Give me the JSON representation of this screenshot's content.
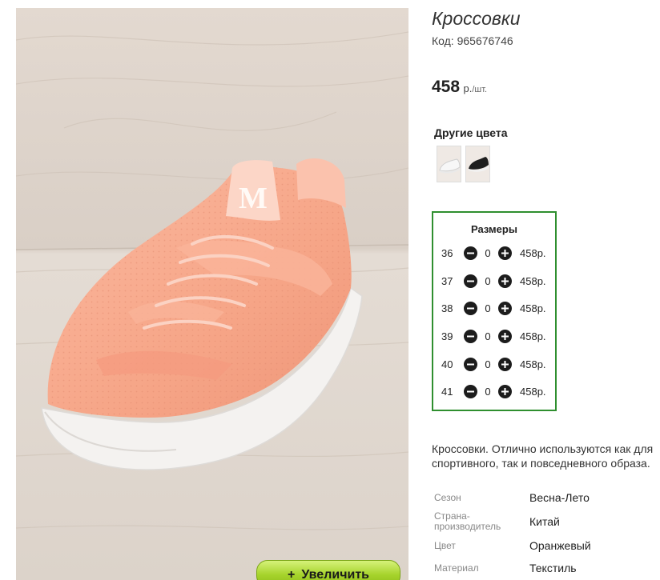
{
  "product": {
    "title": "Кроссовки",
    "code": "Код: 965676746",
    "price_value": "458",
    "price_unit_r": "р.",
    "price_unit_sht": "/шт."
  },
  "photo": {
    "zoom_icon": "+",
    "zoom_label": "Увеличить"
  },
  "colors": {
    "heading": "Другие цвета",
    "swatches": [
      {
        "name": "white-sneaker",
        "color": "#f4f4f4"
      },
      {
        "name": "black-sneaker",
        "color": "#1e1e1e"
      }
    ]
  },
  "sizes": {
    "heading": "Размеры",
    "rows": [
      {
        "size": "36",
        "qty": "0",
        "price": "458р."
      },
      {
        "size": "37",
        "qty": "0",
        "price": "458р."
      },
      {
        "size": "38",
        "qty": "0",
        "price": "458р."
      },
      {
        "size": "39",
        "qty": "0",
        "price": "458р."
      },
      {
        "size": "40",
        "qty": "0",
        "price": "458р."
      },
      {
        "size": "41",
        "qty": "0",
        "price": "458р."
      }
    ]
  },
  "description": "Кроссовки. Отлично используются как для спортивного, так и повседневного образа.",
  "attributes": [
    {
      "label": "Сезон",
      "value": "Весна-Лето"
    },
    {
      "label": "Страна-производитель",
      "value": "Китай"
    },
    {
      "label": "Цвет",
      "value": "Оранжевый"
    },
    {
      "label": "Материал",
      "value": "Текстиль"
    }
  ],
  "colors_theme": {
    "accent_green": "#2f8f2f",
    "zoom_button": "#a6d32b",
    "shoe_upper": "#f7a88e",
    "sole": "#f4f2f0"
  }
}
